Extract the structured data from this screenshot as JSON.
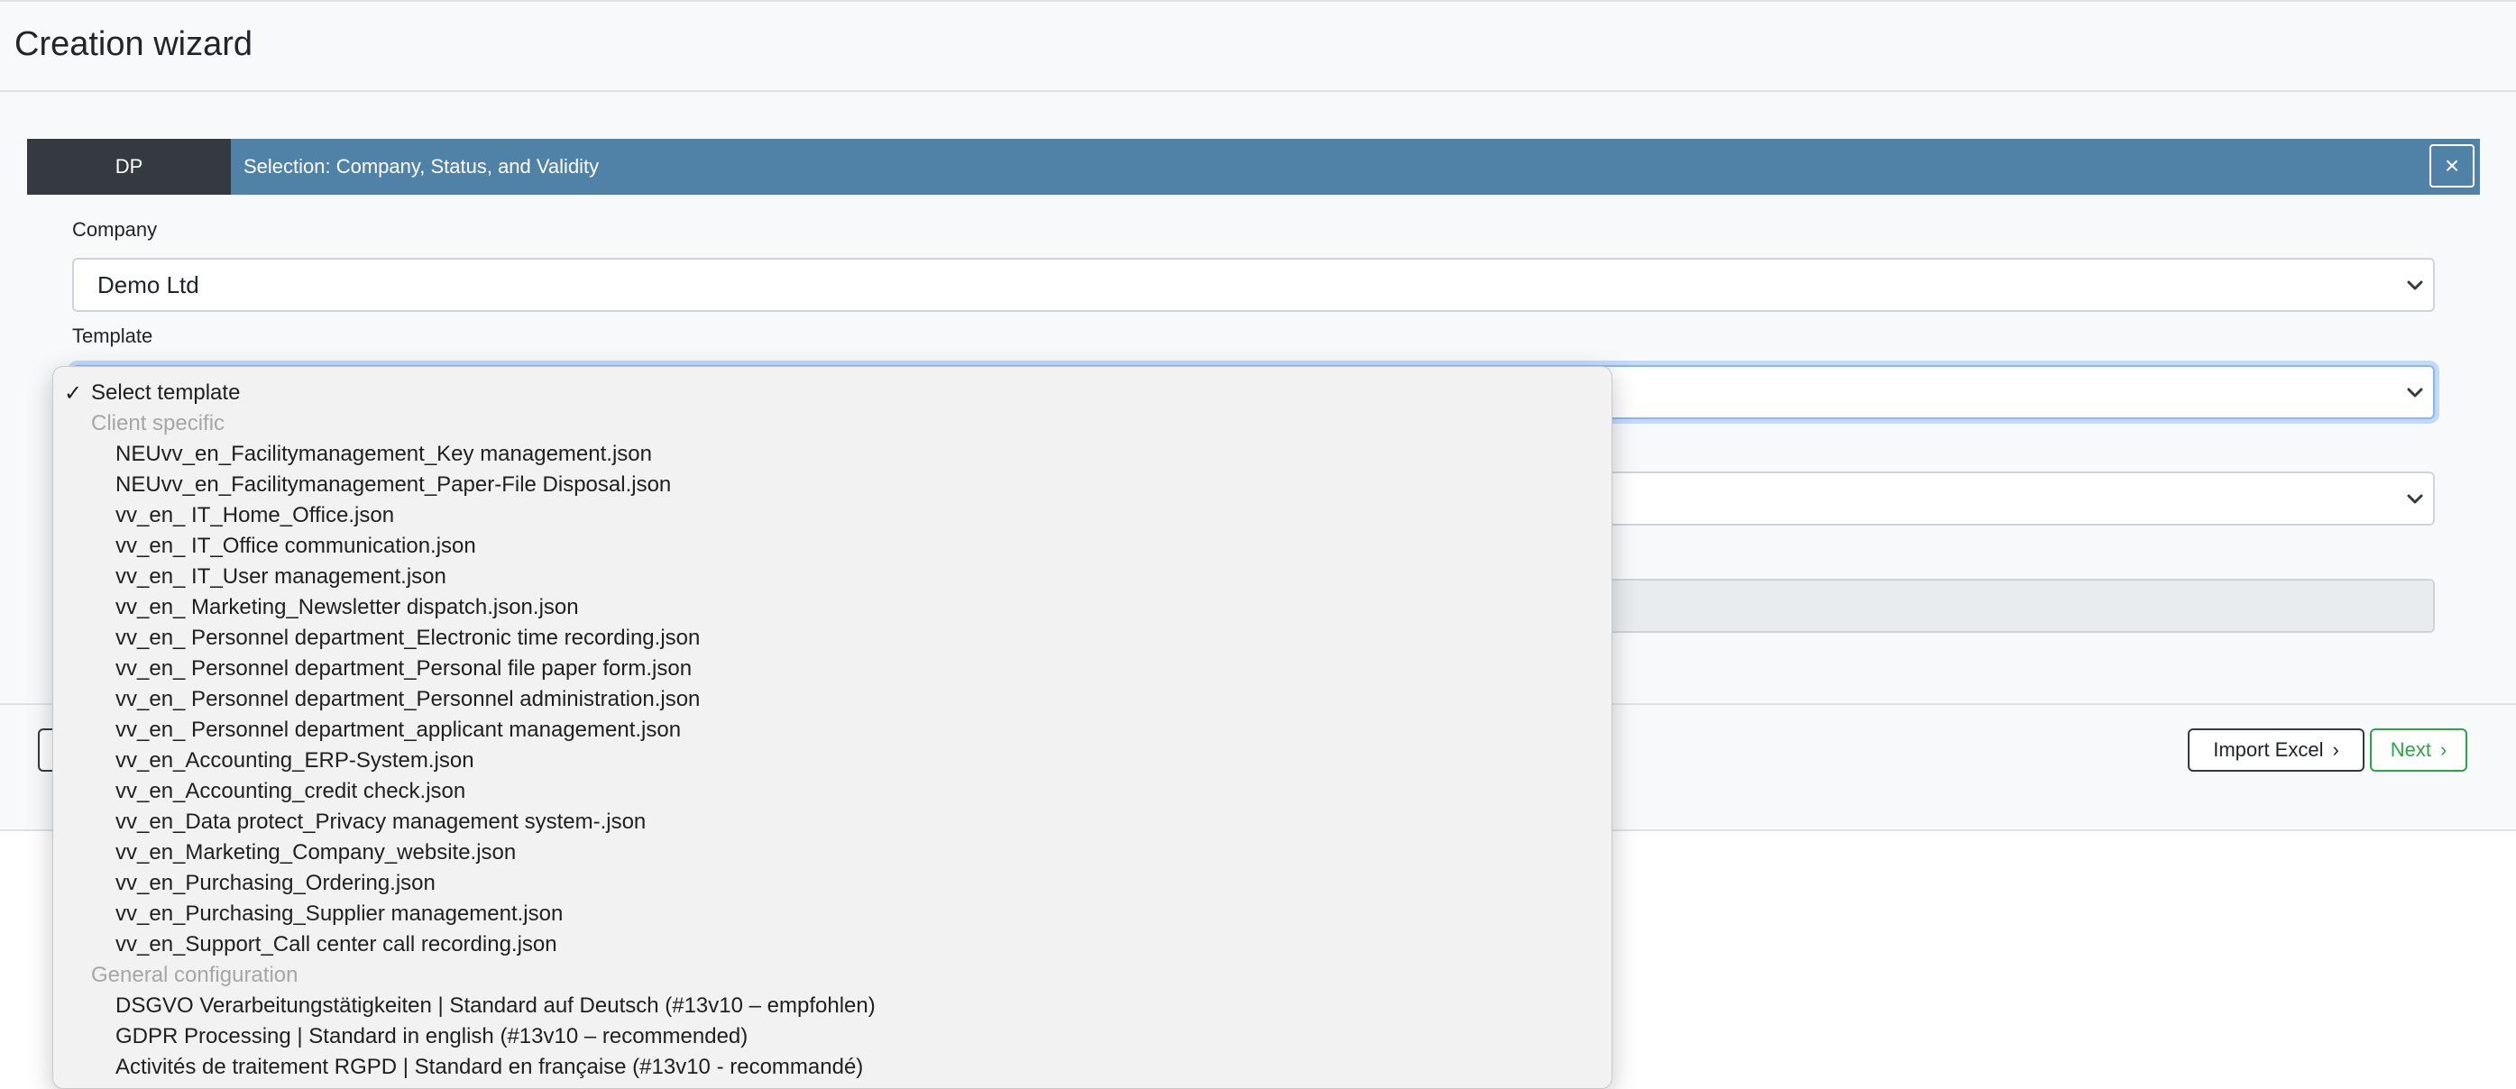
{
  "page": {
    "title": "Creation wizard"
  },
  "card": {
    "badge": "DP",
    "title": "Selection: Company, Status, and Validity",
    "close_icon": "×"
  },
  "form": {
    "company_label": "Company",
    "company_value": "Demo Ltd",
    "template_label": "Template"
  },
  "footer": {
    "import_label": "Import Excel",
    "next_label": "Next",
    "chevron": "›"
  },
  "dropdown": {
    "check_icon": "✓",
    "selected": "Select template",
    "groups": [
      {
        "label": "Client specific",
        "items": [
          "NEUvv_en_Facilitymanagement_Key management.json",
          "NEUvv_en_Facilitymanagement_Paper-File Disposal.json",
          "vv_en_ IT_Home_Office.json",
          "vv_en_ IT_Office communication.json",
          "vv_en_ IT_User management.json",
          "vv_en_ Marketing_Newsletter dispatch.json.json",
          "vv_en_ Personnel department_Electronic time recording.json",
          "vv_en_ Personnel department_Personal file paper form.json",
          "vv_en_ Personnel department_Personnel administration.json",
          "vv_en_ Personnel department_applicant management.json",
          "vv_en_Accounting_ERP-System.json",
          "vv_en_Accounting_credit check.json",
          "vv_en_Data protect_Privacy management system-.json",
          "vv_en_Marketing_Company_website.json",
          "vv_en_Purchasing_Ordering.json",
          "vv_en_Purchasing_Supplier management.json",
          "vv_en_Support_Call center call recording.json"
        ]
      },
      {
        "label": "General configuration",
        "items": [
          "DSGVO Verarbeitungstätigkeiten | Standard auf Deutsch (#13v10 – empfohlen)",
          "GDPR Processing | Standard in english (#13v10 – recommended)",
          "Activités de traitement RGPD | Standard en française (#13v10 - recommandé)"
        ]
      }
    ]
  }
}
